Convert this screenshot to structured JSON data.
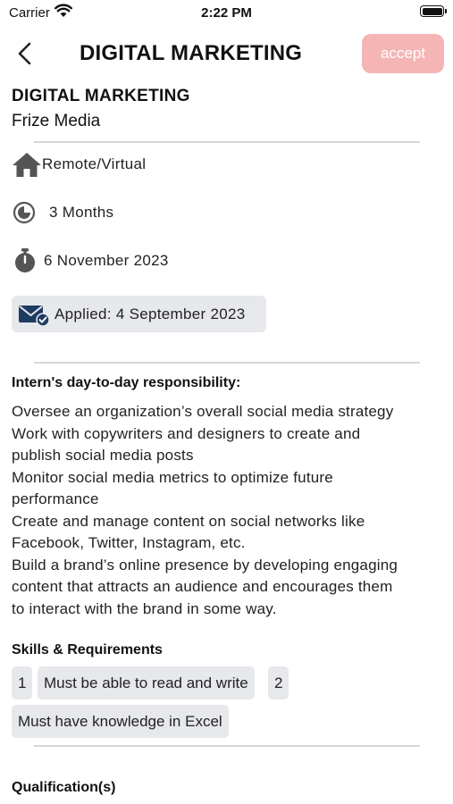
{
  "status_bar": {
    "carrier": "Carrier",
    "time": "2:22 PM"
  },
  "nav": {
    "title": "DIGITAL MARKETING",
    "accept_label": "accept"
  },
  "job": {
    "title": "DIGITAL MARKETING",
    "company": "Frize Media"
  },
  "details": {
    "location": "Remote/Virtual",
    "duration": "3 Months",
    "start_date": "6 November 2023",
    "applied": "Applied: 4 September 2023"
  },
  "responsibilities": {
    "heading": "Intern's day-to-day responsibility:",
    "lines": [
      "Oversee an organization’s overall social media strategy",
      "Work with copywriters and designers to create and",
      "publish social media posts",
      "Monitor social media metrics to optimize future",
      "performance",
      "Create and manage content on social networks like",
      "Facebook, Twitter, Instagram, etc.",
      "Build a brand’s online presence by developing engaging",
      "content that attracts an audience and encourages them",
      "to interact with the brand in some way."
    ]
  },
  "skills": {
    "heading": "Skills & Requirements",
    "items": [
      "1",
      "Must be able to read and write",
      "2",
      "Must have knowledge in Excel"
    ]
  },
  "qualifications": {
    "heading": "Qualification(s)"
  },
  "colors": {
    "accept_bg": "#f5b5b5",
    "chip_bg": "#e6e8eb",
    "divider": "#d6d6d6"
  },
  "icons": [
    "wifi-icon",
    "battery-icon",
    "back-chevron-icon",
    "home-icon",
    "clock-icon",
    "stopwatch-icon",
    "mail-check-icon"
  ]
}
